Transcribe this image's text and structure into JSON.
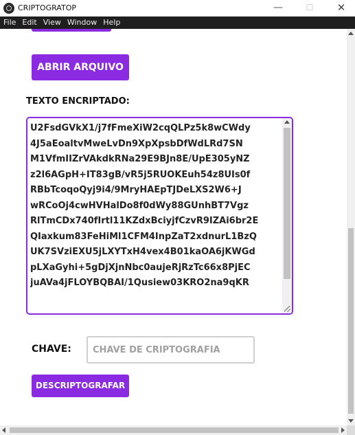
{
  "window": {
    "title": "CRIPTOGRATOP",
    "minimize": "—",
    "maximize": "☐",
    "close": "✕"
  },
  "menu": [
    "File",
    "Edit",
    "View",
    "Window",
    "Help"
  ],
  "main": {
    "open_button": "ABRIR ARQUIVO",
    "encrypted_label": "TEXTO ENCRIPTADO:",
    "encrypted_text": "U2FsdGVkX1/j7fFmeXiW2cqQLPz5k8wCWdy\n4J5aEoaltvMweLvDn9XpXpsbDfWdLRd7SN\nM1VfmIIZrVAkdkRNa29E9BJn8E/UpE305yNZ\nz2l6AGpH+IT83gB/vR5j5RUOKEuh54z8UIs0f\nRBbTcoqoQyj9i4/9MryHAEpTJDeLXS2W6+J\nwRCoOj4cwHVHalDo8f0dWy88GUnhBT7Vgz\nRlTmCDx740fIrtl11KZdxBciyjfCzvR9IZAi6br2E\nQIaxkum83FeHiMl1CFM4InpZaT2xdnurL1BzQ\nUK7SVziEXU5jLXYTxH4vex4B01kaOA6jKWGd\npLXaGyhi+5gDjXjnNbc0aujeRjRzTc66x8PjEC\njuAVa4jFLOYBQBAI/1Qusiew03KRO2na9qKR",
    "key_label": "CHAVE:",
    "key_placeholder": "CHAVE DE CRIPTOGRAFIA",
    "key_value": "",
    "decrypt_button": "DESCRIPTOGRAFAR"
  },
  "colors": {
    "accent": "#8a2be2",
    "menubar": "#1f1f1f"
  }
}
